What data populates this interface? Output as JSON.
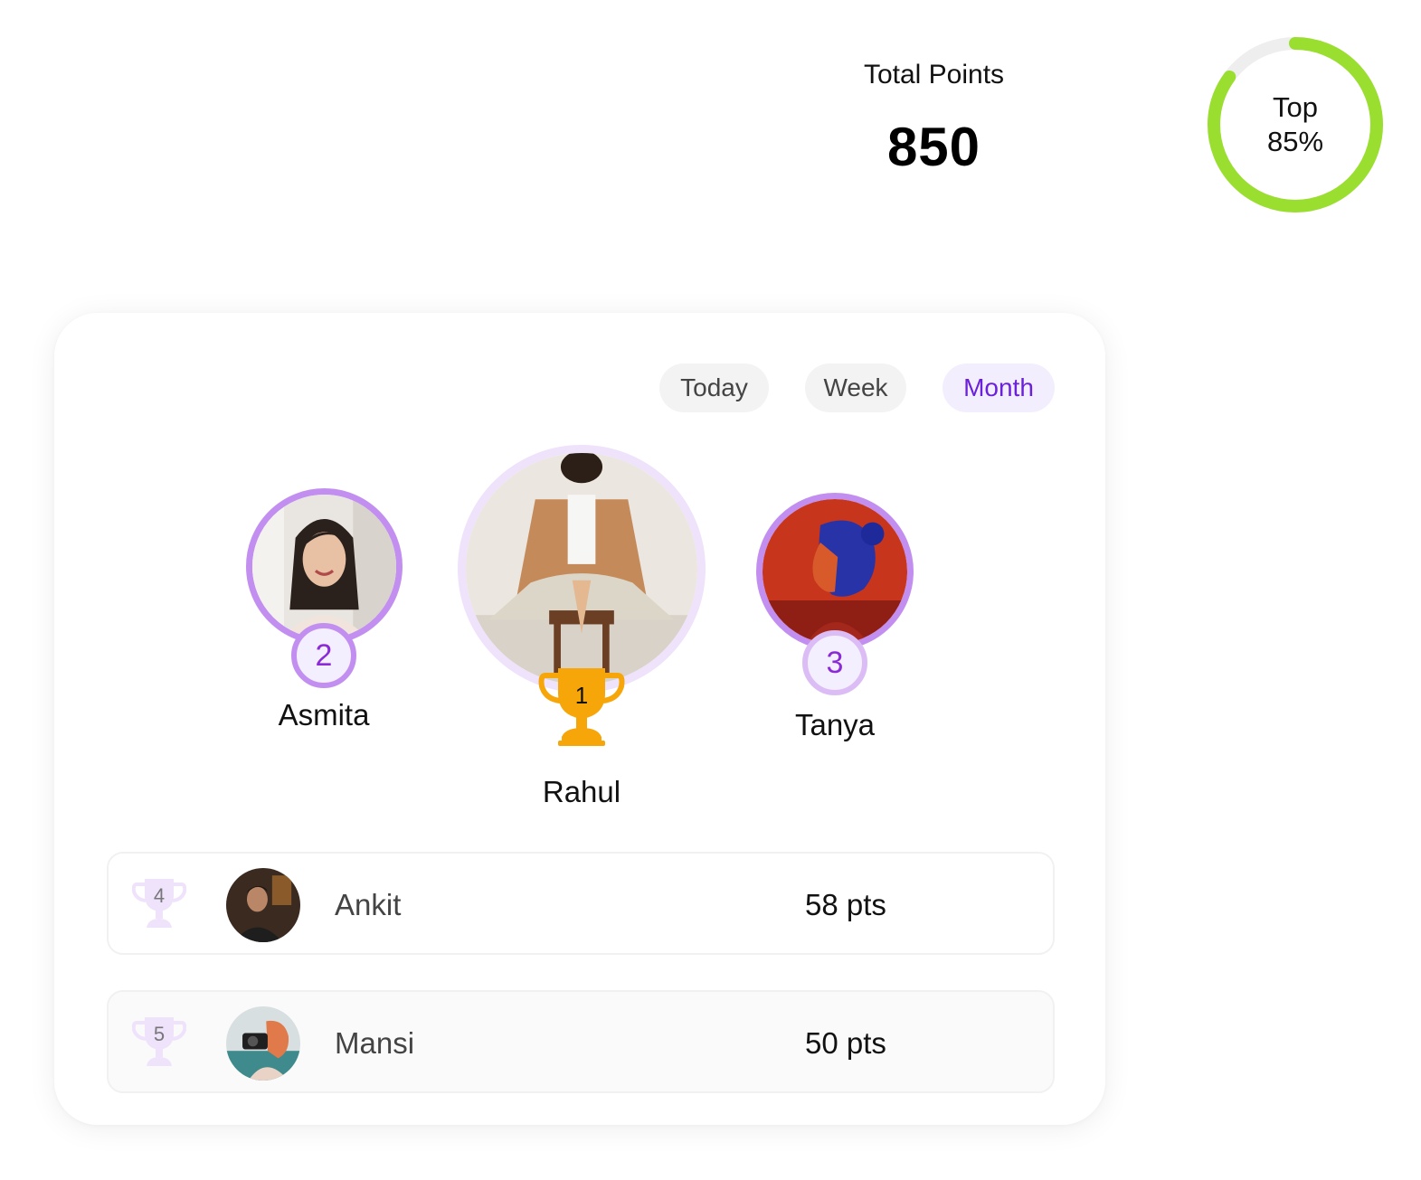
{
  "stats": {
    "total_points_label": "Total Points",
    "total_points_value": "850",
    "top_percent_label": "Top",
    "top_percent_value": "85%",
    "top_percent_fraction": 0.85,
    "ring_color": "#9ade2f",
    "ring_track_color": "#eeeeee"
  },
  "tabs": [
    {
      "label": "Today",
      "active": false
    },
    {
      "label": "Week",
      "active": false
    },
    {
      "label": "Month",
      "active": true
    }
  ],
  "podium": {
    "first": {
      "rank": "1",
      "name": "Rahul",
      "icon": "gold-trophy-icon"
    },
    "second": {
      "rank": "2",
      "name": "Asmita"
    },
    "third": {
      "rank": "3",
      "name": "Tanya"
    }
  },
  "list": [
    {
      "rank": "4",
      "name": "Ankit",
      "points": "58 pts",
      "icon": "trophy-icon"
    },
    {
      "rank": "5",
      "name": "Mansi",
      "points": "50 pts",
      "icon": "trophy-icon"
    }
  ],
  "colors": {
    "accent_purple": "#6b21d9",
    "badge_border": "#c28ff0",
    "trophy_gold": "#f6a609",
    "trophy_light": "#efe2fb"
  }
}
